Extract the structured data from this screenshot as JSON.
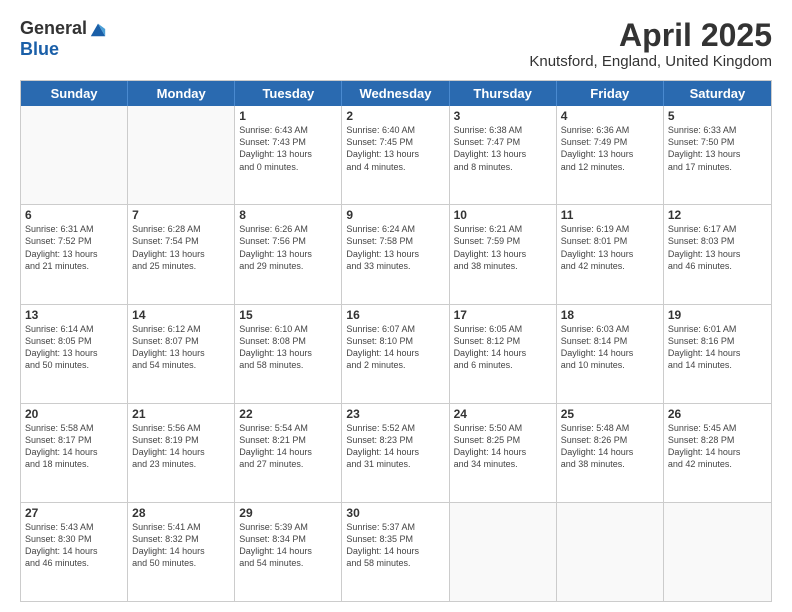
{
  "header": {
    "logo_general": "General",
    "logo_blue": "Blue",
    "month_title": "April 2025",
    "location": "Knutsford, England, United Kingdom"
  },
  "calendar": {
    "days_of_week": [
      "Sunday",
      "Monday",
      "Tuesday",
      "Wednesday",
      "Thursday",
      "Friday",
      "Saturday"
    ],
    "weeks": [
      [
        {
          "day": "",
          "info": ""
        },
        {
          "day": "",
          "info": ""
        },
        {
          "day": "1",
          "info": "Sunrise: 6:43 AM\nSunset: 7:43 PM\nDaylight: 13 hours\nand 0 minutes."
        },
        {
          "day": "2",
          "info": "Sunrise: 6:40 AM\nSunset: 7:45 PM\nDaylight: 13 hours\nand 4 minutes."
        },
        {
          "day": "3",
          "info": "Sunrise: 6:38 AM\nSunset: 7:47 PM\nDaylight: 13 hours\nand 8 minutes."
        },
        {
          "day": "4",
          "info": "Sunrise: 6:36 AM\nSunset: 7:49 PM\nDaylight: 13 hours\nand 12 minutes."
        },
        {
          "day": "5",
          "info": "Sunrise: 6:33 AM\nSunset: 7:50 PM\nDaylight: 13 hours\nand 17 minutes."
        }
      ],
      [
        {
          "day": "6",
          "info": "Sunrise: 6:31 AM\nSunset: 7:52 PM\nDaylight: 13 hours\nand 21 minutes."
        },
        {
          "day": "7",
          "info": "Sunrise: 6:28 AM\nSunset: 7:54 PM\nDaylight: 13 hours\nand 25 minutes."
        },
        {
          "day": "8",
          "info": "Sunrise: 6:26 AM\nSunset: 7:56 PM\nDaylight: 13 hours\nand 29 minutes."
        },
        {
          "day": "9",
          "info": "Sunrise: 6:24 AM\nSunset: 7:58 PM\nDaylight: 13 hours\nand 33 minutes."
        },
        {
          "day": "10",
          "info": "Sunrise: 6:21 AM\nSunset: 7:59 PM\nDaylight: 13 hours\nand 38 minutes."
        },
        {
          "day": "11",
          "info": "Sunrise: 6:19 AM\nSunset: 8:01 PM\nDaylight: 13 hours\nand 42 minutes."
        },
        {
          "day": "12",
          "info": "Sunrise: 6:17 AM\nSunset: 8:03 PM\nDaylight: 13 hours\nand 46 minutes."
        }
      ],
      [
        {
          "day": "13",
          "info": "Sunrise: 6:14 AM\nSunset: 8:05 PM\nDaylight: 13 hours\nand 50 minutes."
        },
        {
          "day": "14",
          "info": "Sunrise: 6:12 AM\nSunset: 8:07 PM\nDaylight: 13 hours\nand 54 minutes."
        },
        {
          "day": "15",
          "info": "Sunrise: 6:10 AM\nSunset: 8:08 PM\nDaylight: 13 hours\nand 58 minutes."
        },
        {
          "day": "16",
          "info": "Sunrise: 6:07 AM\nSunset: 8:10 PM\nDaylight: 14 hours\nand 2 minutes."
        },
        {
          "day": "17",
          "info": "Sunrise: 6:05 AM\nSunset: 8:12 PM\nDaylight: 14 hours\nand 6 minutes."
        },
        {
          "day": "18",
          "info": "Sunrise: 6:03 AM\nSunset: 8:14 PM\nDaylight: 14 hours\nand 10 minutes."
        },
        {
          "day": "19",
          "info": "Sunrise: 6:01 AM\nSunset: 8:16 PM\nDaylight: 14 hours\nand 14 minutes."
        }
      ],
      [
        {
          "day": "20",
          "info": "Sunrise: 5:58 AM\nSunset: 8:17 PM\nDaylight: 14 hours\nand 18 minutes."
        },
        {
          "day": "21",
          "info": "Sunrise: 5:56 AM\nSunset: 8:19 PM\nDaylight: 14 hours\nand 23 minutes."
        },
        {
          "day": "22",
          "info": "Sunrise: 5:54 AM\nSunset: 8:21 PM\nDaylight: 14 hours\nand 27 minutes."
        },
        {
          "day": "23",
          "info": "Sunrise: 5:52 AM\nSunset: 8:23 PM\nDaylight: 14 hours\nand 31 minutes."
        },
        {
          "day": "24",
          "info": "Sunrise: 5:50 AM\nSunset: 8:25 PM\nDaylight: 14 hours\nand 34 minutes."
        },
        {
          "day": "25",
          "info": "Sunrise: 5:48 AM\nSunset: 8:26 PM\nDaylight: 14 hours\nand 38 minutes."
        },
        {
          "day": "26",
          "info": "Sunrise: 5:45 AM\nSunset: 8:28 PM\nDaylight: 14 hours\nand 42 minutes."
        }
      ],
      [
        {
          "day": "27",
          "info": "Sunrise: 5:43 AM\nSunset: 8:30 PM\nDaylight: 14 hours\nand 46 minutes."
        },
        {
          "day": "28",
          "info": "Sunrise: 5:41 AM\nSunset: 8:32 PM\nDaylight: 14 hours\nand 50 minutes."
        },
        {
          "day": "29",
          "info": "Sunrise: 5:39 AM\nSunset: 8:34 PM\nDaylight: 14 hours\nand 54 minutes."
        },
        {
          "day": "30",
          "info": "Sunrise: 5:37 AM\nSunset: 8:35 PM\nDaylight: 14 hours\nand 58 minutes."
        },
        {
          "day": "",
          "info": ""
        },
        {
          "day": "",
          "info": ""
        },
        {
          "day": "",
          "info": ""
        }
      ]
    ]
  }
}
